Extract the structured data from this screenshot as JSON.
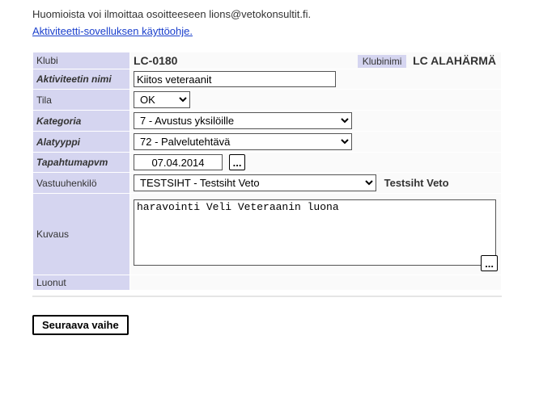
{
  "intro_text": "Huomioista voi ilmoittaa osoitteeseen lions@vetokonsultit.fi.",
  "help_link_text": "Aktiviteetti-sovelluksen käyttöohje.",
  "labels": {
    "klubi": "Klubi",
    "klubinimi": "Klubinimi",
    "aktiviteetin_nimi": "Aktiviteetin nimi",
    "tila": "Tila",
    "kategoria": "Kategoria",
    "alatyyppi": "Alatyyppi",
    "tapahtumapvm": "Tapahtumapvm",
    "vastuuhenkilo": "Vastuuhenkilö",
    "kuvaus": "Kuvaus",
    "luonut": "Luonut"
  },
  "values": {
    "klubi_code": "LC-0180",
    "klubinimi": "LC ALAHÄRMÄ",
    "aktiviteetin_nimi": "Kiitos veteraanit",
    "tila": "OK",
    "kategoria": "7 - Avustus yksilöille",
    "alatyyppi": "72 - Palvelutehtävä",
    "tapahtumapvm": "07.04.2014",
    "vastuuhenkilo_select": "TESTSIHT - Testsiht Veto",
    "vastuuhenkilo_name": "Testsiht Veto",
    "kuvaus": "haravointi Veli Veteraanin luona",
    "luonut": ""
  },
  "buttons": {
    "date_picker": "...",
    "ellipsis": "...",
    "next": "Seuraava vaihe"
  }
}
